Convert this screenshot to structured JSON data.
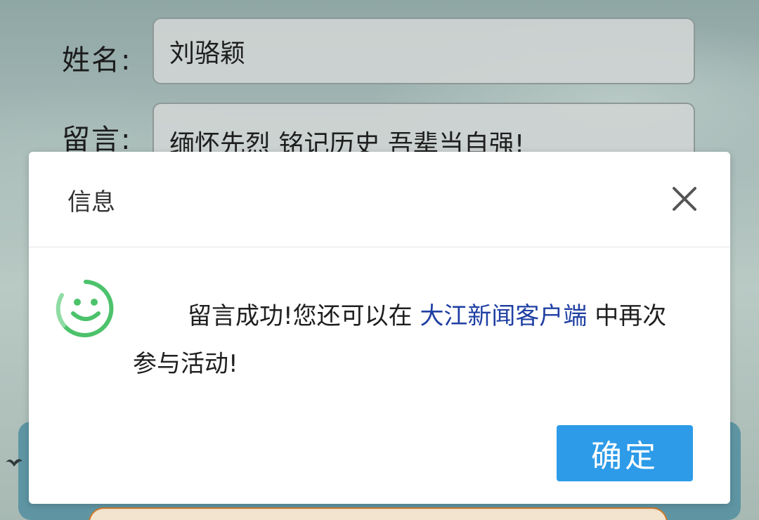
{
  "form": {
    "name_label": "姓名:",
    "name_value": "刘骆颖",
    "message_label": "留言:",
    "message_value": "缅怀先烈 铭记历史 吾辈当自强!"
  },
  "dialog": {
    "title": "信息",
    "close_icon": "close-icon",
    "status_icon": "smile-icon",
    "message_prefix": "留言成功!您还可以在 ",
    "message_link": "大江新闻客户端",
    "message_suffix": " 中再次参与活动!",
    "ok_label": "确定"
  },
  "colors": {
    "accent_button": "#2d9be8",
    "link": "#1f3fa3",
    "smile_icon": "#4cc26b"
  }
}
